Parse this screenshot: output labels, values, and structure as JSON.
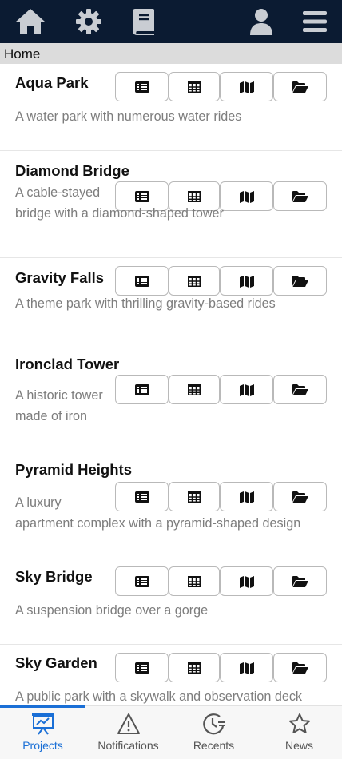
{
  "header": {
    "icons": [
      "home-icon",
      "gear-icon",
      "book-icon",
      "user-icon",
      "menu-icon"
    ],
    "bg_color": "#0b1b32"
  },
  "breadcrumb": {
    "label": "Home"
  },
  "projects": [
    {
      "title": "Aqua Park",
      "description": "A water park with numerous water rides"
    },
    {
      "title": "Diamond Bridge",
      "description": "A cable-stayed bridge with a diamond-shaped tower"
    },
    {
      "title": "Gravity Falls",
      "description": "A theme park with thrilling gravity-based rides"
    },
    {
      "title": "Ironclad Tower",
      "description": "A historic tower made of iron"
    },
    {
      "title": "Pyramid Heights",
      "description": "A luxury apartment complex with a pyramid-shaped design"
    },
    {
      "title": "Sky Bridge",
      "description": "A suspension bridge over a gorge"
    },
    {
      "title": "Sky Garden",
      "description": "A public park with a skywalk and observation deck"
    }
  ],
  "project_actions": [
    "list-icon",
    "table-icon",
    "map-icon",
    "folder-open-icon"
  ],
  "bottom_nav": [
    {
      "label": "Projects",
      "icon": "presentation-chart-icon",
      "active": true
    },
    {
      "label": "Notifications",
      "icon": "warning-icon",
      "active": false
    },
    {
      "label": "Recents",
      "icon": "clock-history-icon",
      "active": false
    },
    {
      "label": "News",
      "icon": "star-icon",
      "active": false
    }
  ],
  "accent_color": "#1a6fd6"
}
